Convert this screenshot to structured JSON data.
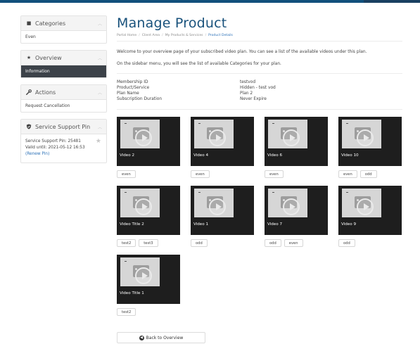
{
  "sidebar": {
    "categories": {
      "title": "Categories",
      "icon": "folder-icon",
      "items": [
        "Even"
      ]
    },
    "overview": {
      "title": "Overview",
      "icon": "star-icon",
      "items": [
        "Information"
      ]
    },
    "actions": {
      "title": "Actions",
      "icon": "wrench-icon",
      "items": [
        "Request Cancellation"
      ]
    },
    "support": {
      "title": "Service Support Pin",
      "icon": "shield-icon",
      "pin_line": "Service Support Pin: 25481",
      "valid_line": "Valid until: 2021-05-12 16:53",
      "renew_link": "(Renew Pin)"
    }
  },
  "main": {
    "title": "Manage Product",
    "breadcrumb": [
      "Portal Home",
      "Client Area",
      "My Products & Services",
      "Product Details"
    ],
    "intro": [
      "Welcome to your overview page of your subscribed video plan. You can see a list of the available videos under this plan.",
      "On the sidebar menu, you will see the list of available Categories for your plan."
    ],
    "details": [
      {
        "label": "Membership ID",
        "value": "testvod"
      },
      {
        "label": "Product/Service",
        "value": "Hidden - test vod"
      },
      {
        "label": "Plan Name",
        "value": "Plan 2"
      },
      {
        "label": "Subscription Duration",
        "value": "Never Expire"
      }
    ],
    "videos": [
      {
        "title": "Video 2",
        "tags": [
          "even"
        ]
      },
      {
        "title": "Video 4",
        "tags": [
          "even"
        ]
      },
      {
        "title": "Video 6",
        "tags": [
          "even"
        ]
      },
      {
        "title": "Video 10",
        "tags": [
          "even",
          "odd"
        ]
      },
      {
        "title": "Video Title 2",
        "tags": [
          "test2",
          "test3"
        ]
      },
      {
        "title": "Video 1",
        "tags": [
          "odd"
        ]
      },
      {
        "title": "Video 7",
        "tags": [
          "odd",
          "even"
        ]
      },
      {
        "title": "Video 9",
        "tags": [
          "odd"
        ]
      },
      {
        "title": "Video Title 1",
        "tags": [
          "test2"
        ]
      }
    ],
    "back_button": "Back to Overview"
  },
  "colors": {
    "accent": "#19527c",
    "link": "#2d72b8",
    "active_item_bg": "#3c4249",
    "thumb_bg": "#1e1e1e"
  }
}
